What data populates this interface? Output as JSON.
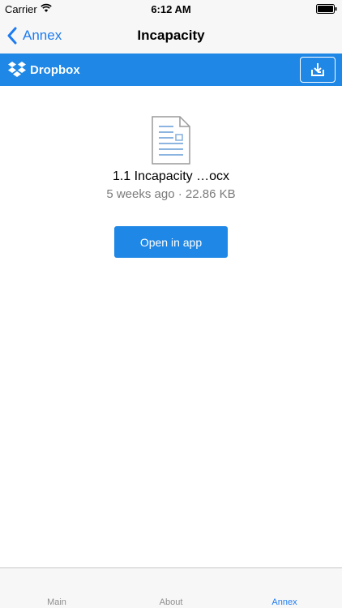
{
  "status_bar": {
    "carrier": "Carrier",
    "time": "6:12 AM"
  },
  "nav": {
    "back_label": "Annex",
    "title": "Incapacity"
  },
  "dropbox": {
    "brand": "Dropbox"
  },
  "file": {
    "name": "1.1 Incapacity …ocx",
    "modified": "5 weeks ago",
    "separator": "·",
    "size": "22.86 KB"
  },
  "actions": {
    "open_in_app": "Open in app"
  },
  "tabs": [
    {
      "label": "Main",
      "active": false
    },
    {
      "label": "About",
      "active": false
    },
    {
      "label": "Annex",
      "active": true
    }
  ],
  "colors": {
    "accent": "#1e7cf0",
    "dropbox_blue": "#1f87e5"
  }
}
